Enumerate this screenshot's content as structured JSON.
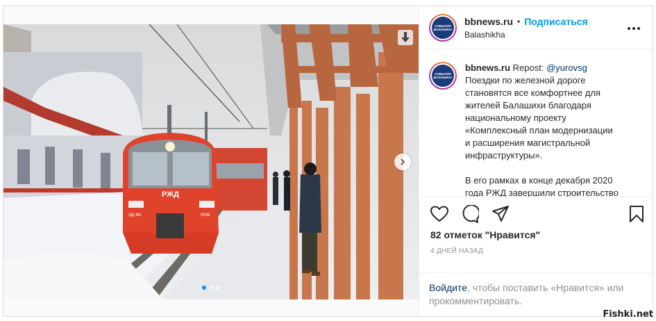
{
  "post": {
    "username": "bbnews.ru",
    "bullet": "•",
    "follow_label": "Подписаться",
    "location": "Balashikha",
    "avatar_text": "СОБЫТИЯ БАЛАШИХА",
    "caption": {
      "username": "bbnews.ru",
      "repost_label": "Repost:",
      "mention": "@yurovsg",
      "paragraph1": "Поездки по железной дороге\nстановятся все комфортнее для\nжителей Балашихи благодаря\nнациональному проекту\n«Комплексный план модернизации\nи расширения магистральной\nинфраструктуры».",
      "paragraph2": "В его рамках в конце декабря 2020\nгода РЖД завершили строительство"
    },
    "likes": "82 отметок \"Нравится\"",
    "time_ago": "4 ДНЕЙ НАЗАД",
    "login_link": "Войдите",
    "login_text": ", чтобы поставить «Нравится» или прокомментировать."
  },
  "photo": {
    "slide_count": 3,
    "active_slide": 1,
    "train_logo": "РЖД",
    "train_number": "0008",
    "train_side_code": "ЭД 4М"
  },
  "icons": {
    "save": "download-arrow-icon",
    "next": "chevron-right-icon",
    "more": "more-horizontal-icon",
    "like": "heart-icon",
    "comment": "comment-bubble-icon",
    "share": "paper-plane-icon",
    "bookmark": "bookmark-icon"
  },
  "colors": {
    "accent": "#0095f6",
    "text": "#262626",
    "muted": "#8e8e8e",
    "link": "#00376b",
    "train_red": "#e0432c"
  },
  "watermark": "Fishki.net"
}
